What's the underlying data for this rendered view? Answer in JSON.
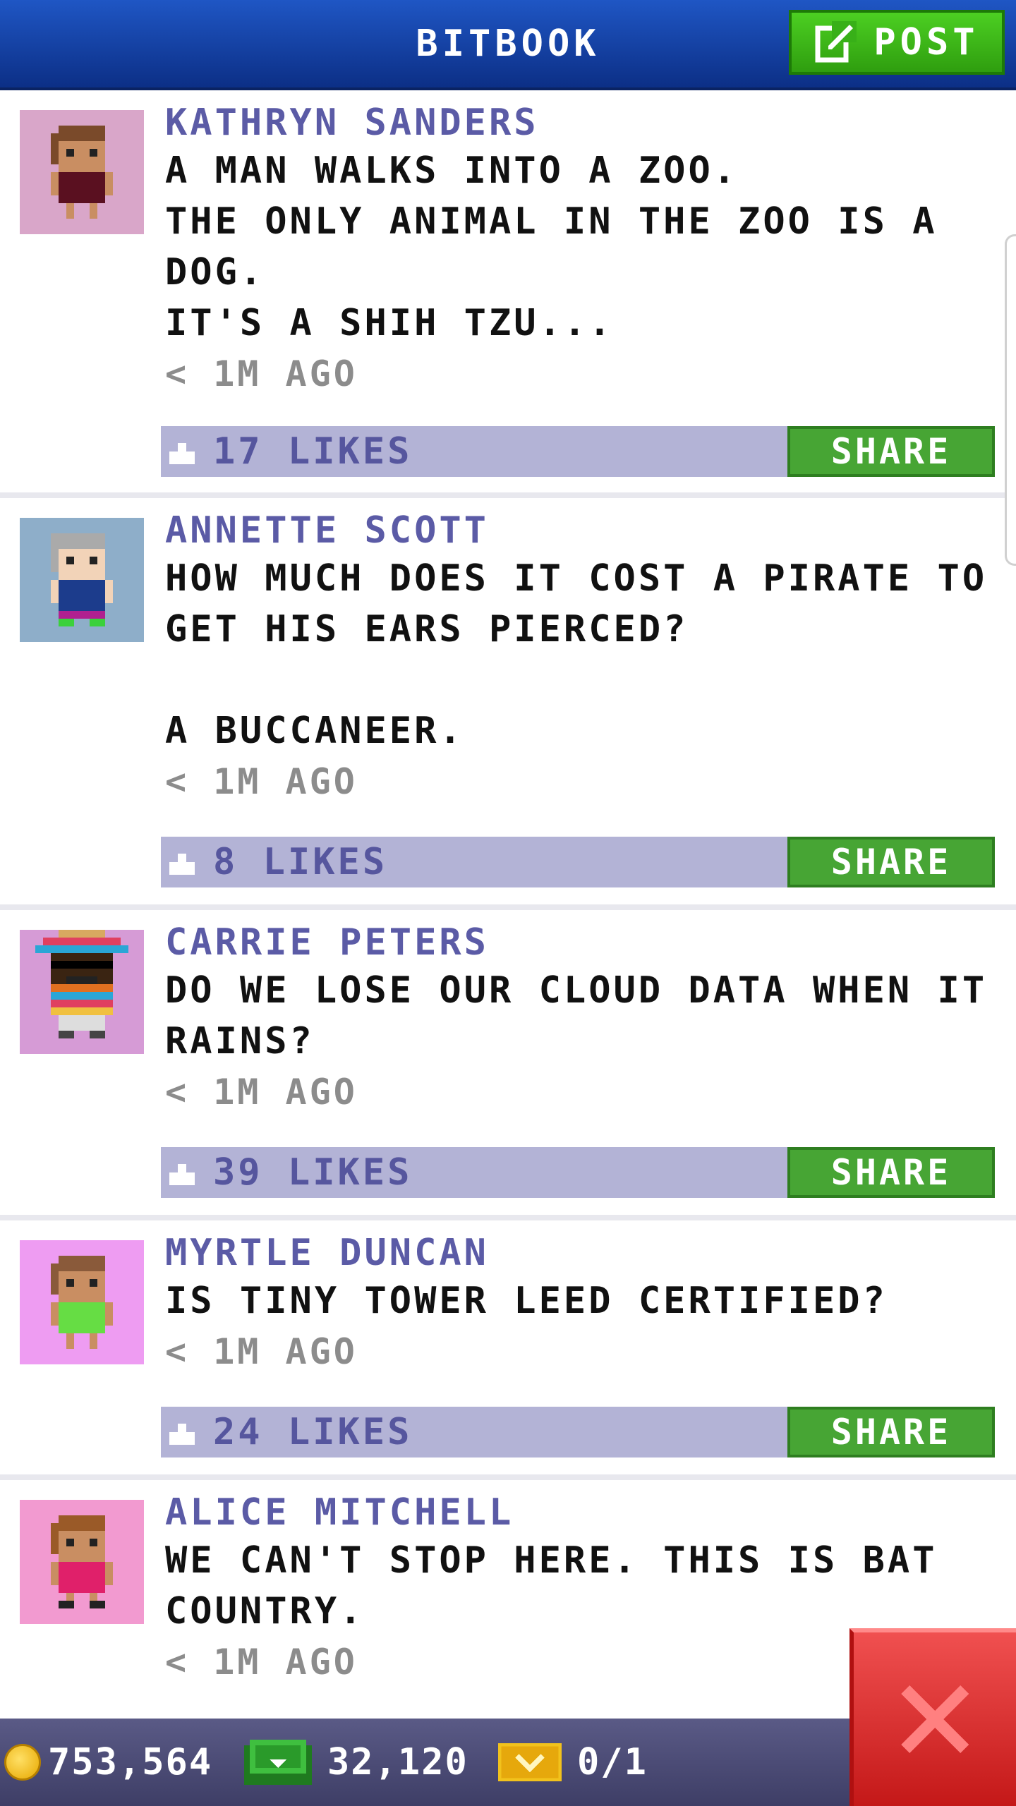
{
  "header": {
    "title": "BITBOOK",
    "post_label": "POST"
  },
  "posts": [
    {
      "author": "KATHRYN SANDERS",
      "message": "A MAN WALKS INTO A ZOO.\nTHE ONLY ANIMAL IN THE ZOO IS A DOG.\nIT'S A SHIH TZU...",
      "time": "< 1M AGO",
      "likes": "17 LIKES",
      "share_label": "SHARE",
      "avatar_bg": "#d9a6c9"
    },
    {
      "author": "ANNETTE SCOTT",
      "message": "HOW MUCH DOES IT COST A PIRATE TO GET HIS EARS PIERCED?\n\nA BUCCANEER.",
      "time": "< 1M AGO",
      "likes": "8 LIKES",
      "share_label": "SHARE",
      "avatar_bg": "#8eaec9"
    },
    {
      "author": "CARRIE PETERS",
      "message": "DO WE LOSE OUR CLOUD DATA WHEN IT RAINS?",
      "time": "< 1M AGO",
      "likes": "39 LIKES",
      "share_label": "SHARE",
      "avatar_bg": "#d69bd6"
    },
    {
      "author": "MYRTLE DUNCAN",
      "message": "IS TINY TOWER LEED CERTIFIED?",
      "time": "< 1M AGO",
      "likes": "24 LIKES",
      "share_label": "SHARE",
      "avatar_bg": "#ee9cf2"
    },
    {
      "author": "ALICE MITCHELL",
      "message": "WE CAN'T STOP HERE. THIS IS BAT COUNTRY.",
      "time": "< 1M AGO",
      "avatar_bg": "#f29ad0"
    }
  ],
  "status": {
    "coins": "753,564",
    "bux": "32,120",
    "tickets": "0/1"
  },
  "icons": {
    "post": "edit-icon",
    "like": "like-icon",
    "coin": "coin-icon",
    "bux": "bux-icon",
    "ticket": "ticket-icon",
    "close": "close-icon"
  },
  "colors": {
    "header": "#1f56c4",
    "accent_green": "#47a534",
    "likes_bar": "#b3b3d6",
    "author": "#5b5ba6",
    "close_red": "#e02c2c"
  }
}
